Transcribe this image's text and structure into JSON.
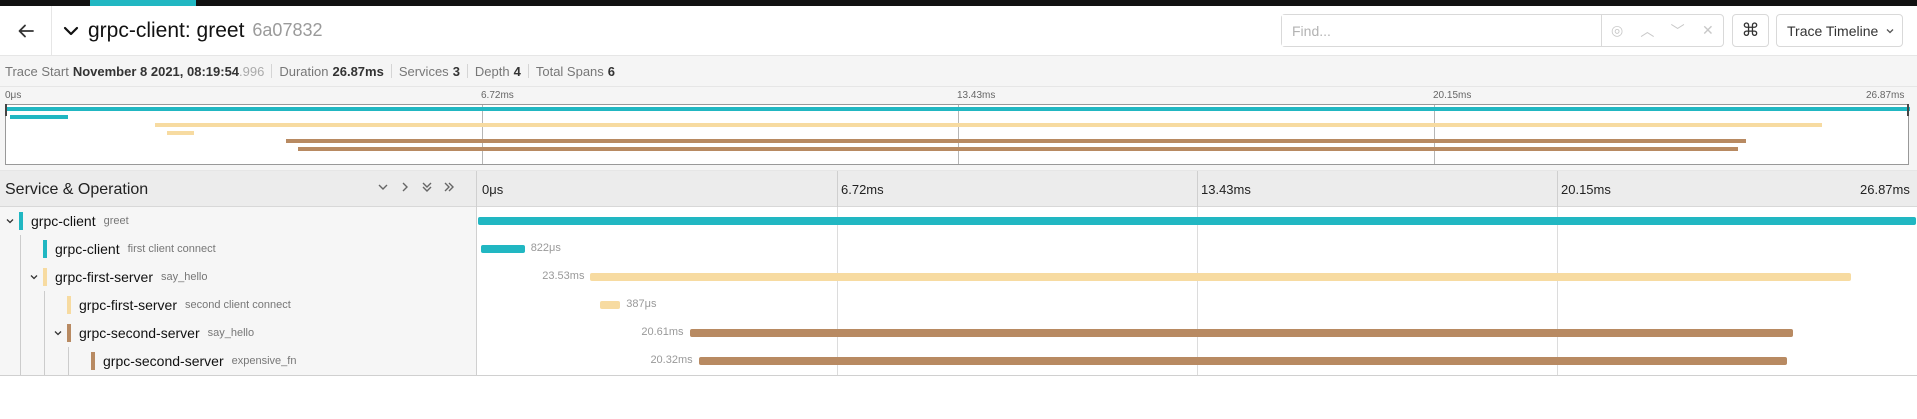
{
  "header": {
    "title": "grpc-client: greet",
    "trace_id": "6a07832",
    "find_placeholder": "Find...",
    "keyboard_shortcut_icon": "⌘",
    "view_select": "Trace Timeline"
  },
  "meta": {
    "trace_start_label": "Trace Start",
    "trace_start_value": "November 8 2021, 08:19:54",
    "trace_start_ms": ".996",
    "duration_label": "Duration",
    "duration_value": "26.87ms",
    "services_label": "Services",
    "services_value": "3",
    "depth_label": "Depth",
    "depth_value": "4",
    "total_spans_label": "Total Spans",
    "total_spans_value": "6"
  },
  "minimap": {
    "ticks": [
      "0μs",
      "6.72ms",
      "13.43ms",
      "20.15ms",
      "26.87ms"
    ]
  },
  "timeline": {
    "header_title": "Service & Operation",
    "ticks": [
      "0μs",
      "6.72ms",
      "13.43ms",
      "20.15ms",
      "26.87ms"
    ],
    "duration_ms": 26.87
  },
  "colors": {
    "grpc-client": "#21b7c2",
    "grpc-first-server": "#f7dba1",
    "grpc-second-server": "#b88a62"
  },
  "spans": [
    {
      "service": "grpc-client",
      "operation": "greet",
      "start_ms": 0,
      "duration_ms": 26.87,
      "duration_label": "",
      "depth": 0,
      "has_children": true
    },
    {
      "service": "grpc-client",
      "operation": "first client connect",
      "start_ms": 0.05,
      "duration_ms": 0.822,
      "duration_label": "822μs",
      "depth": 1,
      "has_children": false
    },
    {
      "service": "grpc-first-server",
      "operation": "say_hello",
      "start_ms": 2.1,
      "duration_ms": 23.53,
      "duration_label": "23.53ms",
      "depth": 1,
      "has_children": true
    },
    {
      "service": "grpc-first-server",
      "operation": "second client connect",
      "start_ms": 2.27,
      "duration_ms": 0.387,
      "duration_label": "387μs",
      "depth": 2,
      "has_children": false
    },
    {
      "service": "grpc-second-server",
      "operation": "say_hello",
      "start_ms": 3.95,
      "duration_ms": 20.61,
      "duration_label": "20.61ms",
      "depth": 2,
      "has_children": true
    },
    {
      "service": "grpc-second-server",
      "operation": "expensive_fn",
      "start_ms": 4.12,
      "duration_ms": 20.32,
      "duration_label": "20.32ms",
      "depth": 3,
      "has_children": false
    }
  ]
}
